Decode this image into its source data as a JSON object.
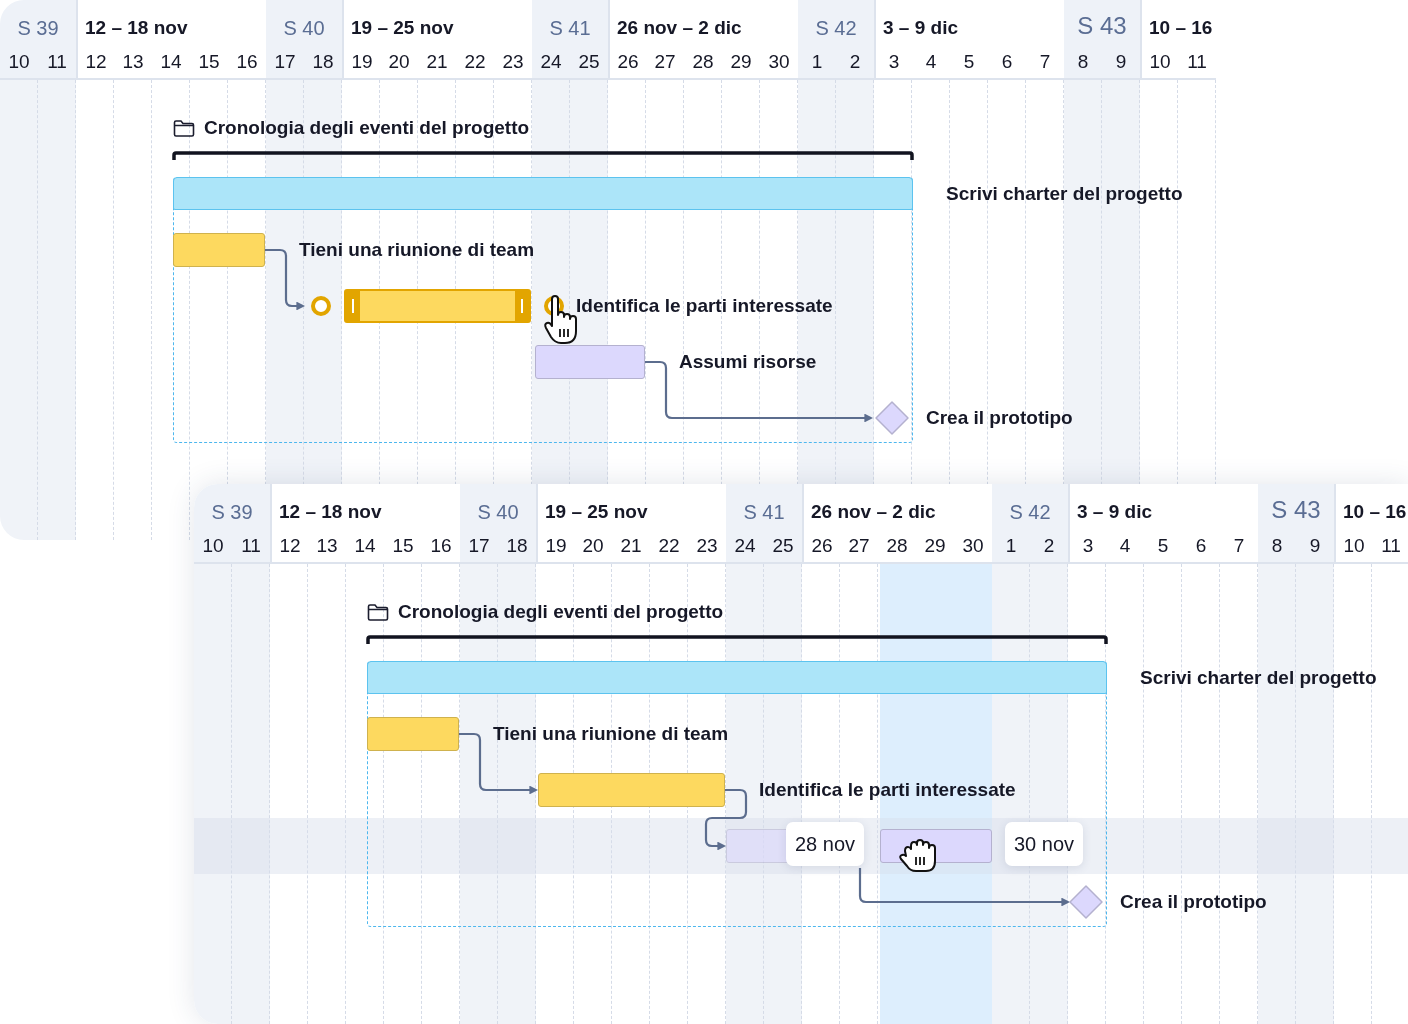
{
  "panels": [
    {
      "header": {
        "weeks": [
          {
            "number": "S 39",
            "range": "12 – 18 nov"
          },
          {
            "number": "S 40",
            "range": "19 – 25 nov"
          },
          {
            "number": "S 41",
            "range": "26 nov – 2 dic"
          },
          {
            "number": "S 42",
            "range": "3 – 9 dic"
          },
          {
            "number": "S 43",
            "range": "10 – 16"
          }
        ],
        "days": [
          "10",
          "11",
          "12",
          "13",
          "14",
          "15",
          "16",
          "17",
          "18",
          "19",
          "20",
          "21",
          "22",
          "23",
          "24",
          "25",
          "26",
          "27",
          "28",
          "29",
          "30",
          "1",
          "2",
          "3",
          "4",
          "5",
          "6",
          "7",
          "8",
          "9",
          "10",
          "11"
        ]
      },
      "group": {
        "title": "Cronologia degli eventi del progetto",
        "name": "Scrivi charter del progetto"
      },
      "tasks": [
        {
          "kind": "bar",
          "name": "Tieni una riunione di team",
          "color": "#fdd95f",
          "selected": false
        },
        {
          "kind": "bar",
          "name": "Identifica le parti interessate",
          "color": "#fdd95f",
          "selected": true
        },
        {
          "kind": "bar",
          "name": "Assumi risorse",
          "color": "#dcd8fd",
          "selected": false
        },
        {
          "kind": "milestone",
          "name": "Crea il prototipo",
          "color": "#dcd8fd"
        }
      ]
    },
    {
      "header": {
        "weeks": [
          {
            "number": "S 39",
            "range": "12 – 18 nov"
          },
          {
            "number": "S 40",
            "range": "19 – 25 nov"
          },
          {
            "number": "S 41",
            "range": "26 nov – 2 dic"
          },
          {
            "number": "S 42",
            "range": "3 – 9 dic"
          },
          {
            "number": "S 43",
            "range": "10 – 16"
          }
        ],
        "days": [
          "10",
          "11",
          "12",
          "13",
          "14",
          "15",
          "16",
          "17",
          "18",
          "19",
          "20",
          "21",
          "22",
          "23",
          "24",
          "25",
          "26",
          "27",
          "28",
          "29",
          "30",
          "1",
          "2",
          "3",
          "4",
          "5",
          "6",
          "7",
          "8",
          "9",
          "10",
          "11"
        ]
      },
      "group": {
        "title": "Cronologia degli eventi del progetto",
        "name": "Scrivi charter del progetto"
      },
      "tasks": [
        {
          "kind": "bar",
          "name": "Tieni una riunione di team",
          "color": "#fdd95f",
          "selected": false
        },
        {
          "kind": "bar",
          "name": "Identifica le parti interessate",
          "color": "#fdd95f",
          "selected": false
        },
        {
          "kind": "bar",
          "color": "#dcd8fd",
          "selected": false,
          "drag": {
            "from": "28 nov",
            "to": "30 nov"
          }
        },
        {
          "kind": "milestone",
          "name": "Crea il prototipo",
          "color": "#dcd8fd"
        }
      ]
    }
  ]
}
